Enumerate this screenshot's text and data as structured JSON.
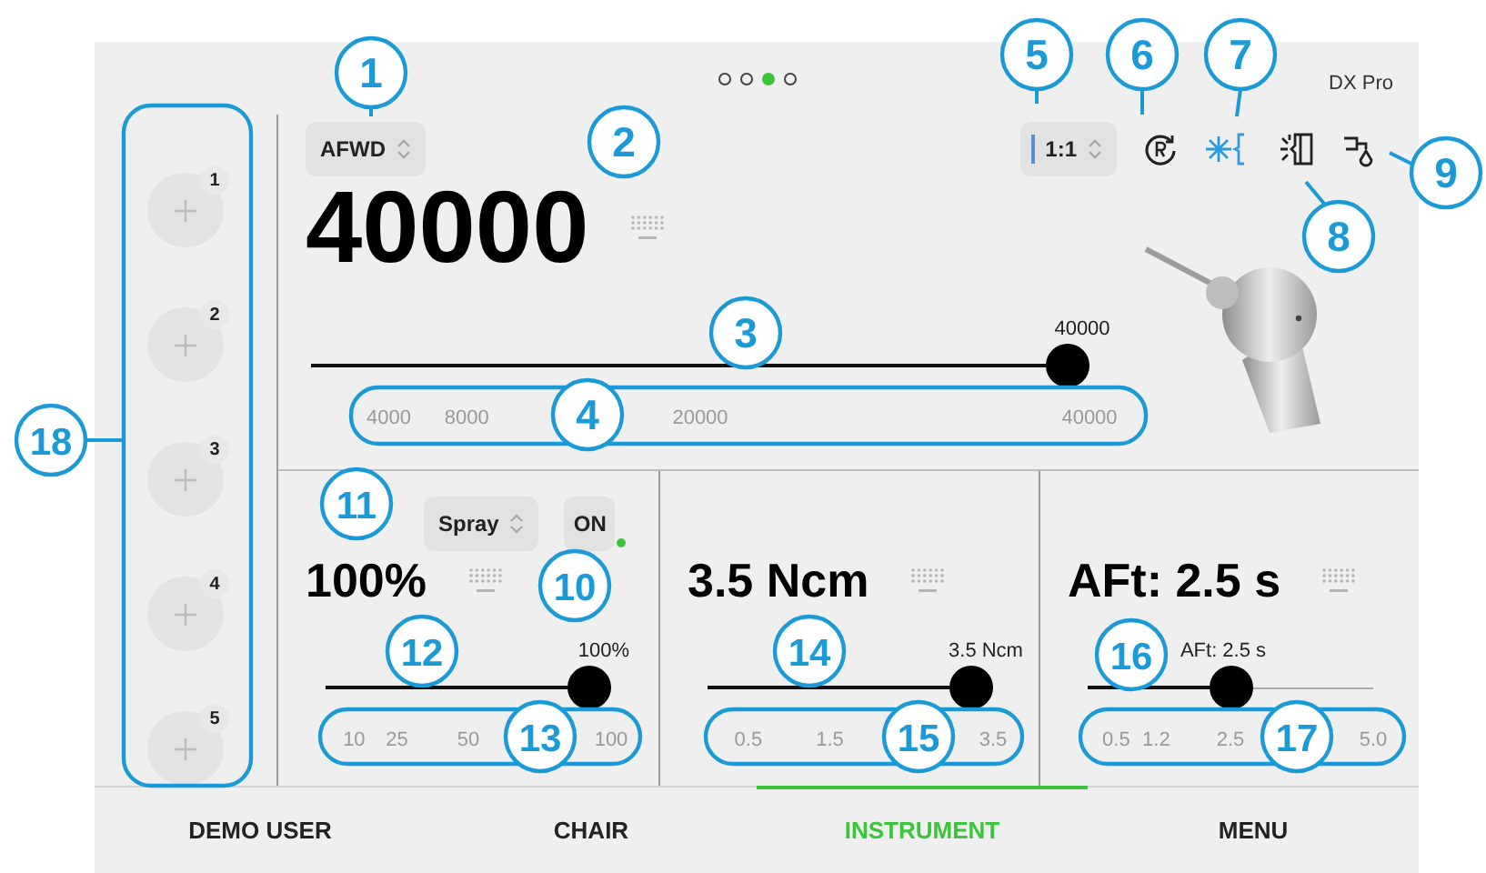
{
  "pager": [
    {
      "selected": false
    },
    {
      "selected": false
    },
    {
      "selected": true
    },
    {
      "selected": false
    }
  ],
  "device": "DX Pro",
  "mode_selector": "AFWD",
  "speed": {
    "value": "40000",
    "level": 1,
    "reading": "40000",
    "ticks": [
      "4000",
      "8000",
      "20000",
      "40000"
    ]
  },
  "ratio_selector": "1:1",
  "function_icons": [
    {
      "kind": "rotation",
      "active": false
    },
    {
      "kind": "spray",
      "active": true
    },
    {
      "kind": "light",
      "active": false
    },
    {
      "kind": "water",
      "active": false
    }
  ],
  "memory_slots": [
    "1",
    "2",
    "3",
    "4",
    "5"
  ],
  "panels": [
    {
      "selector": "Spray",
      "toggle": {
        "label": "ON",
        "on": true
      },
      "value": "100%",
      "level": 1,
      "reading": "100%",
      "ticks": [
        "10",
        "25",
        "50",
        "100"
      ]
    },
    {
      "value": "3.5 Ncm",
      "level": 1,
      "reading": "3.5 Ncm",
      "ticks": [
        "0.5",
        "1.5",
        "3.5"
      ]
    },
    {
      "value": "AFt: 2.5 s",
      "level": 0.5,
      "reading": "AFt: 2.5 s",
      "ticks": [
        "0.5",
        "1.2",
        "2.5",
        "5.0"
      ]
    }
  ],
  "nav_tabs": [
    {
      "label": "DEMO USER",
      "selected": false
    },
    {
      "label": "CHAIR",
      "selected": false
    },
    {
      "label": "INSTRUMENT",
      "selected": true
    },
    {
      "label": "MENU",
      "selected": false
    }
  ],
  "callouts": [
    "1",
    "2",
    "3",
    "4",
    "5",
    "6",
    "7",
    "8",
    "9",
    "10",
    "11",
    "12",
    "13",
    "14",
    "15",
    "16",
    "17",
    "18"
  ]
}
